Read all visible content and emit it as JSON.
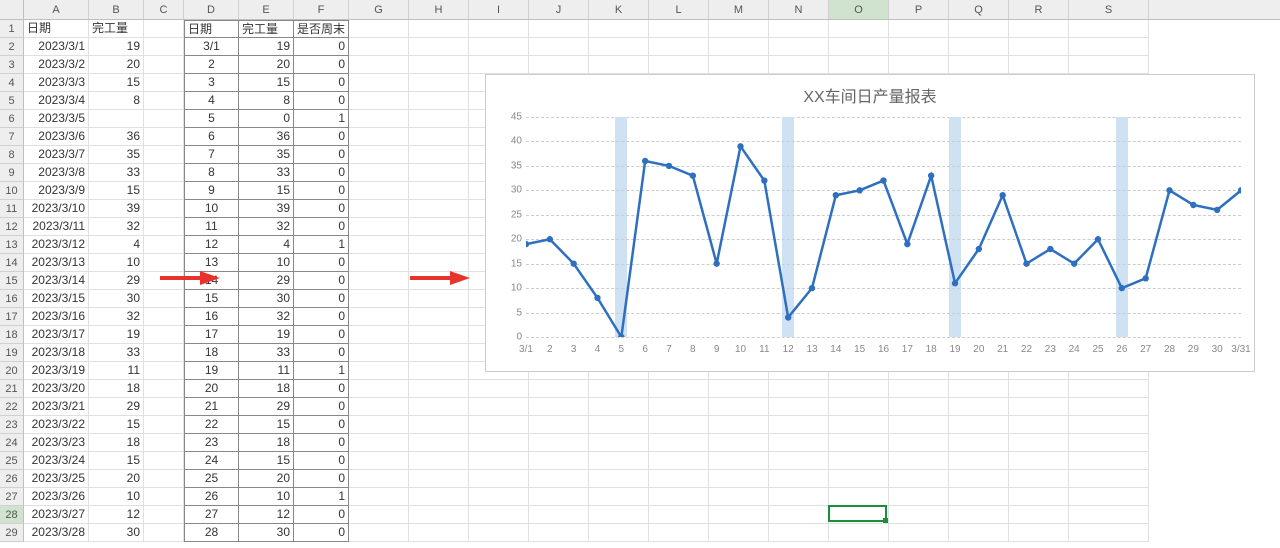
{
  "columns": {
    "labels": [
      "A",
      "B",
      "C",
      "D",
      "E",
      "F",
      "G",
      "H",
      "I",
      "J",
      "K",
      "L",
      "M",
      "N",
      "O",
      "P",
      "Q",
      "R",
      "S"
    ],
    "widths": [
      65,
      55,
      40,
      55,
      55,
      55,
      60,
      60,
      60,
      60,
      60,
      60,
      60,
      60,
      60,
      60,
      60,
      60,
      80
    ],
    "selected": "O"
  },
  "rows": {
    "count": 29,
    "selected": 28
  },
  "header_row": {
    "A": "日期",
    "B": "完工量",
    "D": "日期",
    "E": "完工量",
    "F": "是否周末"
  },
  "data_AB": [
    [
      "2023/3/1",
      "19"
    ],
    [
      "2023/3/2",
      "20"
    ],
    [
      "2023/3/3",
      "15"
    ],
    [
      "2023/3/4",
      "8"
    ],
    [
      "2023/3/5",
      ""
    ],
    [
      "2023/3/6",
      "36"
    ],
    [
      "2023/3/7",
      "35"
    ],
    [
      "2023/3/8",
      "33"
    ],
    [
      "2023/3/9",
      "15"
    ],
    [
      "2023/3/10",
      "39"
    ],
    [
      "2023/3/11",
      "32"
    ],
    [
      "2023/3/12",
      "4"
    ],
    [
      "2023/3/13",
      "10"
    ],
    [
      "2023/3/14",
      "29"
    ],
    [
      "2023/3/15",
      "30"
    ],
    [
      "2023/3/16",
      "32"
    ],
    [
      "2023/3/17",
      "19"
    ],
    [
      "2023/3/18",
      "33"
    ],
    [
      "2023/3/19",
      "11"
    ],
    [
      "2023/3/20",
      "18"
    ],
    [
      "2023/3/21",
      "29"
    ],
    [
      "2023/3/22",
      "15"
    ],
    [
      "2023/3/23",
      "18"
    ],
    [
      "2023/3/24",
      "15"
    ],
    [
      "2023/3/25",
      "20"
    ],
    [
      "2023/3/26",
      "10"
    ],
    [
      "2023/3/27",
      "12"
    ],
    [
      "2023/3/28",
      "30"
    ]
  ],
  "data_DEF": [
    [
      "3/1",
      "19",
      "0"
    ],
    [
      "2",
      "20",
      "0"
    ],
    [
      "3",
      "15",
      "0"
    ],
    [
      "4",
      "8",
      "0"
    ],
    [
      "5",
      "0",
      "1"
    ],
    [
      "6",
      "36",
      "0"
    ],
    [
      "7",
      "35",
      "0"
    ],
    [
      "8",
      "33",
      "0"
    ],
    [
      "9",
      "15",
      "0"
    ],
    [
      "10",
      "39",
      "0"
    ],
    [
      "11",
      "32",
      "0"
    ],
    [
      "12",
      "4",
      "1"
    ],
    [
      "13",
      "10",
      "0"
    ],
    [
      "14",
      "29",
      "0"
    ],
    [
      "15",
      "30",
      "0"
    ],
    [
      "16",
      "32",
      "0"
    ],
    [
      "17",
      "19",
      "0"
    ],
    [
      "18",
      "33",
      "0"
    ],
    [
      "19",
      "11",
      "1"
    ],
    [
      "20",
      "18",
      "0"
    ],
    [
      "21",
      "29",
      "0"
    ],
    [
      "22",
      "15",
      "0"
    ],
    [
      "23",
      "18",
      "0"
    ],
    [
      "24",
      "15",
      "0"
    ],
    [
      "25",
      "20",
      "0"
    ],
    [
      "26",
      "10",
      "1"
    ],
    [
      "27",
      "12",
      "0"
    ],
    [
      "28",
      "30",
      "0"
    ]
  ],
  "active_cell": {
    "col": "O",
    "row": 28
  },
  "chart_data": {
    "type": "line",
    "title": "XX车间日产量报表",
    "ylim": [
      0,
      45
    ],
    "yticks": [
      0,
      5,
      10,
      15,
      20,
      25,
      30,
      35,
      40,
      45
    ],
    "categories": [
      "3/1",
      "2",
      "3",
      "4",
      "5",
      "6",
      "7",
      "8",
      "9",
      "10",
      "11",
      "12",
      "13",
      "14",
      "15",
      "16",
      "17",
      "18",
      "19",
      "20",
      "21",
      "22",
      "23",
      "24",
      "25",
      "26",
      "27",
      "28",
      "29",
      "30",
      "3/31"
    ],
    "series": [
      {
        "name": "完工量",
        "values": [
          19,
          20,
          15,
          8,
          0,
          36,
          35,
          33,
          15,
          39,
          32,
          4,
          10,
          29,
          30,
          32,
          19,
          33,
          11,
          18,
          29,
          15,
          18,
          15,
          20,
          10,
          12,
          30,
          27,
          26,
          30
        ]
      }
    ],
    "weekend_bars": {
      "indices": [
        4,
        11,
        18,
        25
      ],
      "value": 45
    }
  }
}
